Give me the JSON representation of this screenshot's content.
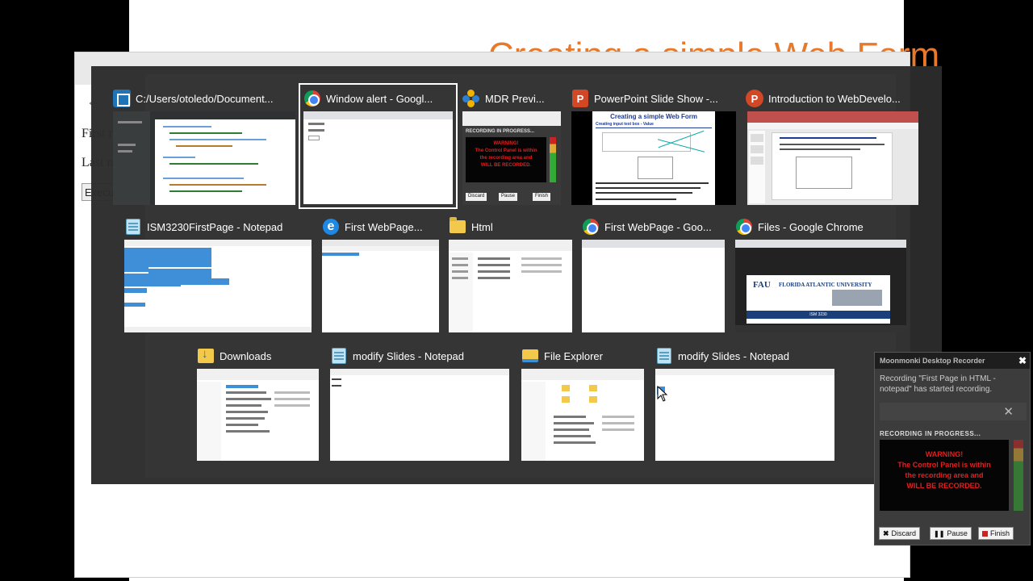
{
  "background": {
    "slide_title_fragment": "Creating a simple Web Form",
    "page_lines": [
      "First n",
      "Last n"
    ],
    "execute_label": "Execu"
  },
  "switcher": {
    "windows": [
      {
        "title": "C:/Users/otoledo/Document...",
        "icon": "brackets-icon"
      },
      {
        "title": "Window alert - Googl...",
        "icon": "chrome-icon",
        "selected": true
      },
      {
        "title": "MDR Previ...",
        "icon": "mdr-icon"
      },
      {
        "title": "PowerPoint Slide Show -...",
        "icon": "powerpoint-icon"
      },
      {
        "title": "Introduction to WebDevelo...",
        "icon": "powerpoint-icon"
      },
      {
        "title": "ISM3230FirstPage - Notepad",
        "icon": "notepad-icon"
      },
      {
        "title": "First WebPage...",
        "icon": "edge-icon"
      },
      {
        "title": "Html",
        "icon": "folder-icon"
      },
      {
        "title": "First WebPage - Goo...",
        "icon": "chrome-icon"
      },
      {
        "title": "Files - Google Chrome",
        "icon": "chrome-icon"
      },
      {
        "title": "Downloads",
        "icon": "downloads-folder-icon"
      },
      {
        "title": "modify Slides - Notepad",
        "icon": "notepad-icon"
      },
      {
        "title": "File Explorer",
        "icon": "file-explorer-icon"
      },
      {
        "title": "modify Slides - Notepad",
        "icon": "notepad-icon"
      }
    ],
    "thumb_text": {
      "mdr_progress": "RECORDING IN PROGRESS...",
      "mdr_warning_1": "WARNING!",
      "mdr_warning_2": "The Control Panel is within",
      "mdr_warning_3": "the recording area and",
      "mdr_warning_4": "WILL BE RECORDED.",
      "mdr_discard": "Discard",
      "mdr_pause": "Pause",
      "mdr_finish": "Finish",
      "ppt_slide_title": "Creating a simple Web Form",
      "ppt_slide_subtitle": "Creating input text box - Value",
      "fau_name": "FLORIDA ATLANTIC UNIVERSITY",
      "fau_logo": "FAU",
      "fau_course": "ISM 3230"
    }
  },
  "recorder": {
    "title": "Moonmonki Desktop Recorder",
    "message": "Recording \"First Page in HTML - notepad\" has started recording.",
    "progress": "RECORDING IN PROGRESS...",
    "warning_1": "WARNING!",
    "warning_2": "The Control Panel is within",
    "warning_3": "the recording area and",
    "warning_4": "WILL BE RECORDED.",
    "discard": "Discard",
    "pause": "Pause",
    "finish": "Finish"
  }
}
